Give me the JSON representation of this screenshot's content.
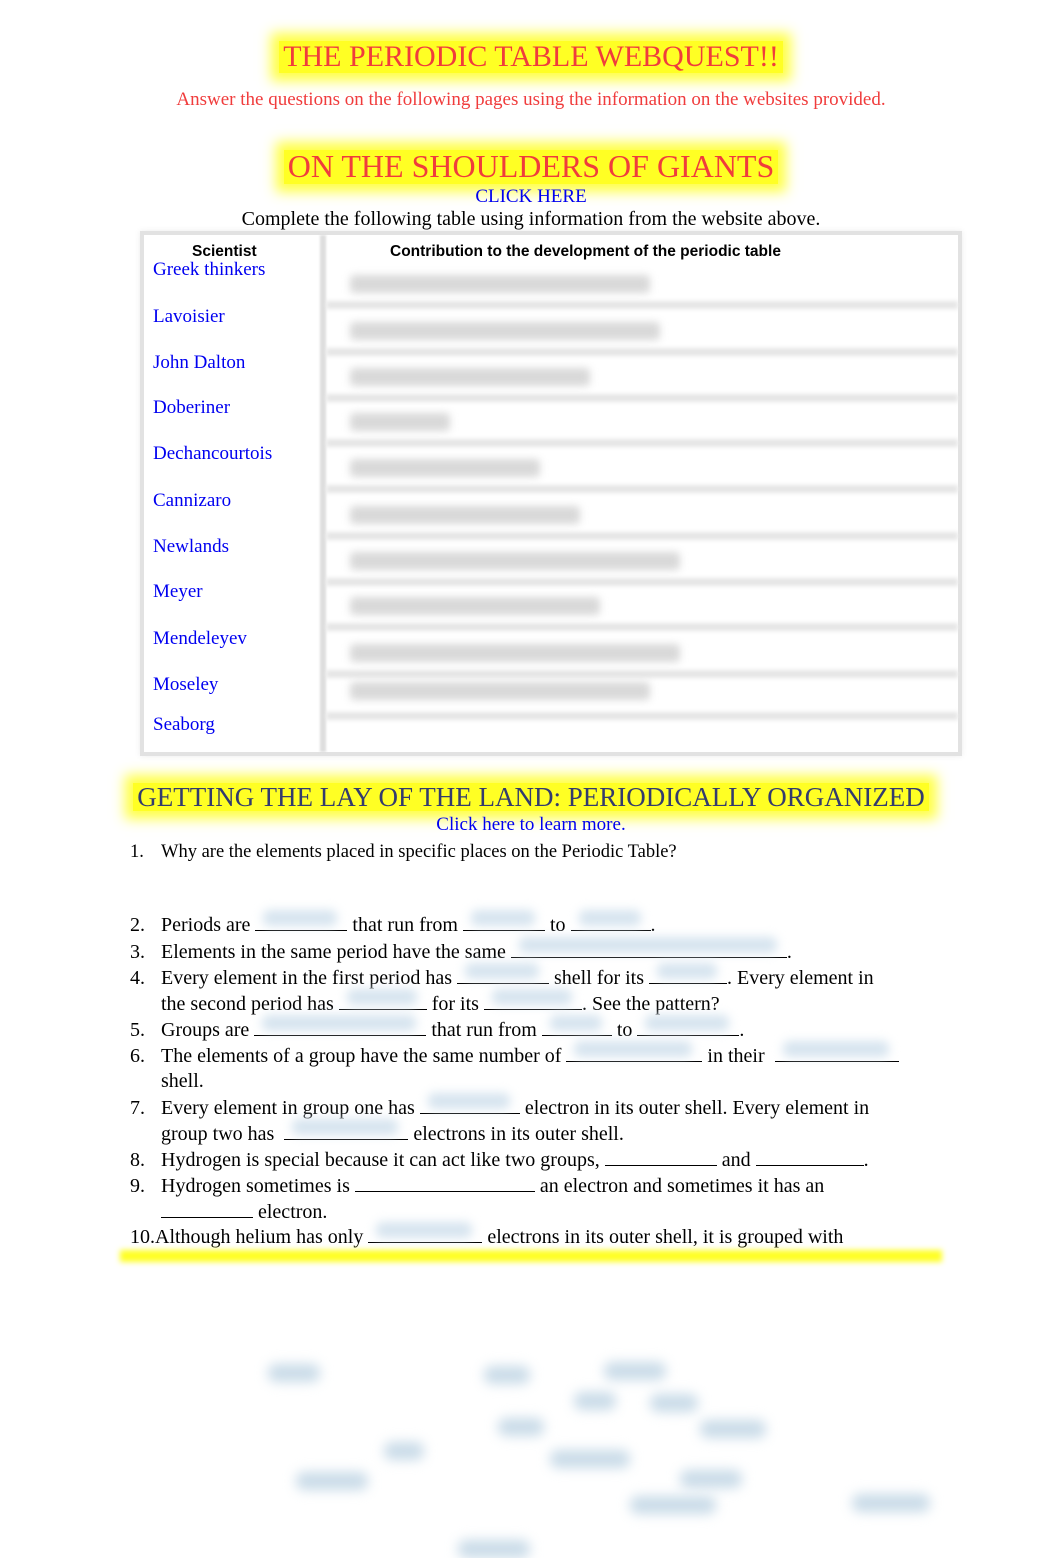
{
  "header": {
    "title": "THE PERIODIC TABLE WEBQUEST!!",
    "subtitle": "Answer the questions on the following pages using the information on the websites provided."
  },
  "section1": {
    "title": "ON THE SHOULDERS OF GIANTS",
    "link": "CLICK HERE",
    "instructions": "Complete the following table using information from the website above.",
    "table": {
      "headers": [
        "Scientist",
        "Contribution to the development of the periodic table"
      ],
      "rows": [
        {
          "scientist": "Greek thinkers"
        },
        {
          "scientist": "Lavoisier"
        },
        {
          "scientist": "John Dalton"
        },
        {
          "scientist": "Doberiner"
        },
        {
          "scientist": "Dechancourtois"
        },
        {
          "scientist": "Cannizaro"
        },
        {
          "scientist": "Newlands"
        },
        {
          "scientist": "Meyer"
        },
        {
          "scientist": "Mendeleyev"
        },
        {
          "scientist": "Moseley"
        },
        {
          "scientist": "Seaborg"
        }
      ]
    }
  },
  "section2": {
    "title": "GETTING THE LAY OF THE LAND: PERIODICALLY ORGANIZED",
    "link": "Click here to learn more.",
    "questions": [
      {
        "num": "1.",
        "parts": [
          "Why are the elements placed in specific places on the Periodic Table?"
        ]
      },
      {
        "num": "2.",
        "parts": [
          "Periods are ",
          " that run from ",
          " to ",
          "."
        ]
      },
      {
        "num": "3.",
        "parts": [
          "Elements in the same period have the same ",
          "."
        ]
      },
      {
        "num": "4.",
        "parts": [
          "Every element in the first period has ",
          " shell for its ",
          ".  Every element in",
          "the second period has ",
          " for its ",
          ".  See the pattern?"
        ]
      },
      {
        "num": "5.",
        "parts": [
          "Groups are ",
          " that run from ",
          " to ",
          "."
        ]
      },
      {
        "num": "6.",
        "parts": [
          "The elements of a group have the same number of ",
          " in their ",
          "shell."
        ]
      },
      {
        "num": "7.",
        "parts": [
          "Every element in group one has ",
          " electron in its outer shell.  Every element in",
          "group two has ",
          " electrons in its outer shell."
        ]
      },
      {
        "num": "8.",
        "parts": [
          "Hydrogen is special because it can act like two groups, ",
          " and ",
          "."
        ]
      },
      {
        "num": "9.",
        "parts": [
          "Hydrogen sometimes is ",
          " an electron and sometimes it has an",
          " electron."
        ]
      },
      {
        "num": "10.",
        "parts": [
          "Although helium has only ",
          " electrons in its outer shell, it is grouped with"
        ]
      }
    ]
  }
}
